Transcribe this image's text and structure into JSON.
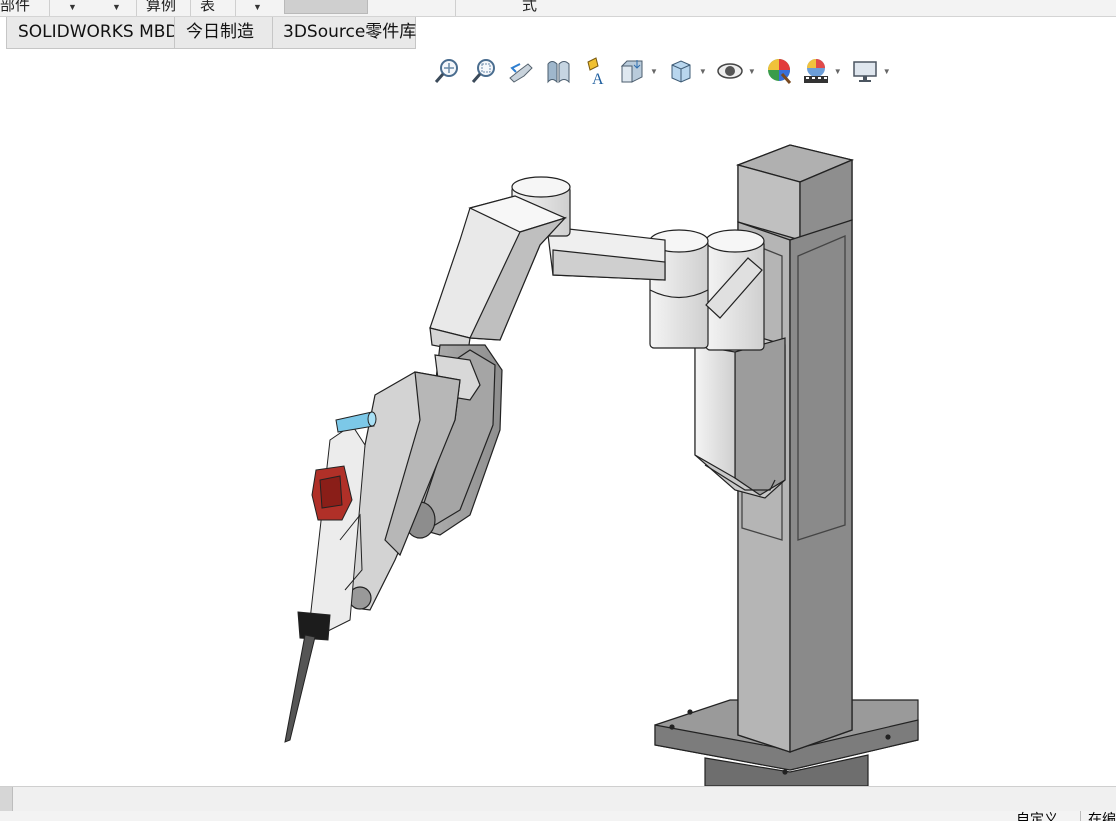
{
  "ribbon": {
    "items": [
      "部件",
      "算例",
      "表",
      "式"
    ]
  },
  "tabs": [
    "SOLIDWORKS MBD",
    "今日制造",
    "3DSource零件库"
  ],
  "view_toolbar": {
    "buttons": [
      {
        "name": "zoom-to-fit-icon"
      },
      {
        "name": "zoom-to-area-icon"
      },
      {
        "name": "previous-view-icon"
      },
      {
        "name": "section-view-icon"
      },
      {
        "name": "dynamic-annotation-views-icon"
      },
      {
        "name": "view-orientation-icon",
        "dropdown": true
      },
      {
        "name": "display-style-icon",
        "dropdown": true
      },
      {
        "name": "hide-show-items-icon",
        "dropdown": true
      },
      {
        "name": "edit-appearance-icon"
      },
      {
        "name": "apply-scene-icon",
        "dropdown": true
      },
      {
        "name": "view-settings-icon",
        "dropdown": true
      }
    ]
  },
  "statusbar": {
    "left": "自定义",
    "right": "在编"
  },
  "colors": {
    "background": "#ffffff",
    "arm_light": "#e8e8e8",
    "arm_mid": "#c9c9c9",
    "column": "#a9a9a9",
    "gripper_red": "#b03028",
    "accent_blue": "#7cc8e8"
  }
}
